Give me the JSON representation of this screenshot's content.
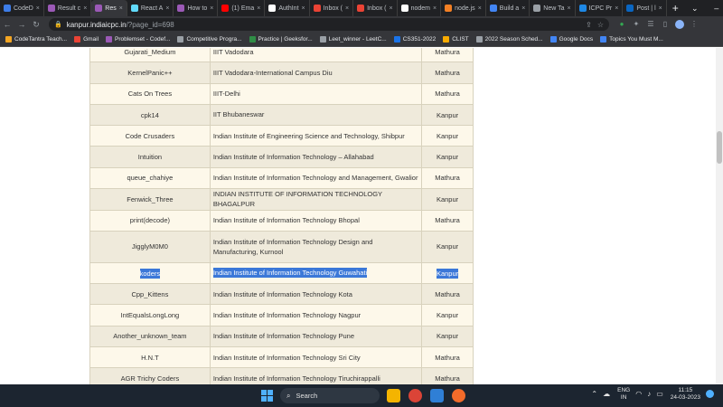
{
  "tabs": [
    {
      "label": "CodeD",
      "color": "#3d7de8"
    },
    {
      "label": "Result c",
      "color": "#9b59b6"
    },
    {
      "label": "Res",
      "color": "#9b59b6",
      "active": true
    },
    {
      "label": "React A",
      "color": "#61dafb"
    },
    {
      "label": "How to",
      "color": "#9b59b6"
    },
    {
      "label": "(1) Ema",
      "color": "#ff0000"
    },
    {
      "label": "AuthInt",
      "color": "#ffffff"
    },
    {
      "label": "Inbox (",
      "color": "#ea4335"
    },
    {
      "label": "Inbox (",
      "color": "#ea4335"
    },
    {
      "label": "nodem",
      "color": "#ffffff"
    },
    {
      "label": "node.js",
      "color": "#f48024"
    },
    {
      "label": "Build a",
      "color": "#4285f4"
    },
    {
      "label": "New Ta",
      "color": "#9aa0a6"
    },
    {
      "label": "ICPC Pr",
      "color": "#1e88e5"
    },
    {
      "label": "Post | l",
      "color": "#0a66c2"
    }
  ],
  "toolbar": {
    "url_host": "kanpur.indiaicpc.in",
    "url_path": "/?page_id=698"
  },
  "bookmarks": [
    {
      "label": "CodeTantra Teach...",
      "color": "#f5a623"
    },
    {
      "label": "Gmail",
      "color": "#ea4335"
    },
    {
      "label": "Problemset - Codef...",
      "color": "#9b59b6"
    },
    {
      "label": "Competitive Progra...",
      "color": "#9aa0a6"
    },
    {
      "label": "Practice | Geeksfor...",
      "color": "#2f8d46"
    },
    {
      "label": "Leet_winner - LeetC...",
      "color": "#9aa0a6"
    },
    {
      "label": "CS351-2022",
      "color": "#1a73e8"
    },
    {
      "label": "CLIST",
      "color": "#f9ab00"
    },
    {
      "label": "2022 Season Sched...",
      "color": "#9aa0a6"
    },
    {
      "label": "Google Docs",
      "color": "#4285f4"
    },
    {
      "label": "Topics You Must M...",
      "color": "#4285f4"
    }
  ],
  "rows": [
    {
      "team": "Gujarati_Medium",
      "institute": "IIIT Vadodara",
      "site": "Mathura"
    },
    {
      "team": "KernelPanic++",
      "institute": "IIIT Vadodara-International Campus Diu",
      "site": "Mathura"
    },
    {
      "team": "Cats On Trees",
      "institute": "IIIT-Delhi",
      "site": "Mathura"
    },
    {
      "team": "cpk14",
      "institute": "IIT Bhubaneswar",
      "site": "Kanpur"
    },
    {
      "team": "Code Crusaders",
      "institute": "Indian Institute of Engineering Science and Technology, Shibpur",
      "site": "Kanpur"
    },
    {
      "team": "Intuition",
      "institute": "Indian Institute of Information Technology – Allahabad",
      "site": "Kanpur"
    },
    {
      "team": "queue_chahiye",
      "institute": "Indian Institute of Information Technology and Management, Gwalior",
      "site": "Mathura"
    },
    {
      "team": "Fenwick_Three",
      "institute": "INDIAN INSTITUTE OF INFORMATION TECHNOLOGY BHAGALPUR",
      "site": "Kanpur"
    },
    {
      "team": "print(decode)",
      "institute": "Indian Institute of Information Technology Bhopal",
      "site": "Mathura"
    },
    {
      "team": "JigglyM0M0",
      "institute": "Indian Institute of Information Technology Design and Manufacturing,   Kurnool",
      "site": "Kanpur",
      "tall": true
    },
    {
      "team": "koders",
      "institute": "Indian Institute of Information Technology Guwahati",
      "site": "Kanpur",
      "selected": true
    },
    {
      "team": "Cpp_Kittens",
      "institute": "Indian Institute of Information Technology Kota",
      "site": "Mathura"
    },
    {
      "team": "IntEqualsLongLong",
      "institute": "Indian Institute of Information Technology Nagpur",
      "site": "Kanpur"
    },
    {
      "team": "Another_unknown_team",
      "institute": "Indian Institute of Information Technology Pune",
      "site": "Kanpur"
    },
    {
      "team": "H.N.T",
      "institute": "Indian Institute of Information Technology Sri City",
      "site": "Mathura"
    },
    {
      "team": "AGR Trichy Coders",
      "institute": "Indian Institute of Information Technology Tiruchirappalli",
      "site": "Mathura"
    }
  ],
  "taskbar": {
    "search_label": "Search",
    "lang_top": "ENG",
    "lang_bottom": "IN",
    "time": "11:15",
    "date": "24-03-2023"
  }
}
